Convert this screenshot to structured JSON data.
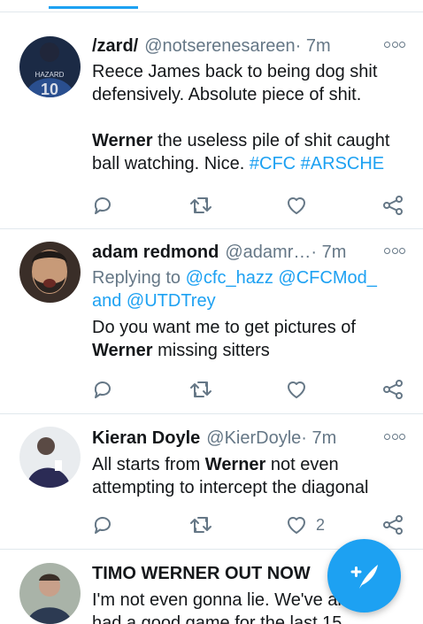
{
  "tweets": [
    {
      "name": "/zard/",
      "handle": "@notserenesareen",
      "time": " · 7m",
      "jersey_text": "HAZARD",
      "jersey_number": "10",
      "text_line1": "Reece James back to being dog shit defensively. Absolute piece of shit.",
      "text_bold": "Werner",
      "text_line2": " the useless pile of shit caught ball watching. Nice. ",
      "hashtag1": "#CFC",
      "hashtag2": "#ARSCHE",
      "like_count": ""
    },
    {
      "name": "adam redmond",
      "handle": "@adamr…",
      "time": " · 7m",
      "replying_prefix": "Replying to ",
      "replying_to": "@cfc_hazz @CFCMod_ and @UTDTrey",
      "text_before": "Do you want me to get pictures of ",
      "text_bold": "Werner",
      "text_after": " missing sitters",
      "like_count": ""
    },
    {
      "name": "Kieran Doyle",
      "handle": "@KierDoyle",
      "time": " · 7m",
      "text_before": "All starts from ",
      "text_bold": "Werner",
      "text_after": " not even attempting to intercept the diagonal",
      "like_count": "2"
    },
    {
      "name": "TIMO WERNER OUT NOW",
      "text": "I'm not even gonna lie. We've already had a good game for the last 15"
    }
  ],
  "icons": {
    "reply": "reply-icon",
    "retweet": "retweet-icon",
    "like": "heart-icon",
    "share": "share-icon",
    "more": "more-icon",
    "compose": "compose-tweet-icon"
  },
  "colors": {
    "accent": "#1da1f2",
    "secondary_text": "#657786",
    "divider": "#e1e8ed"
  }
}
